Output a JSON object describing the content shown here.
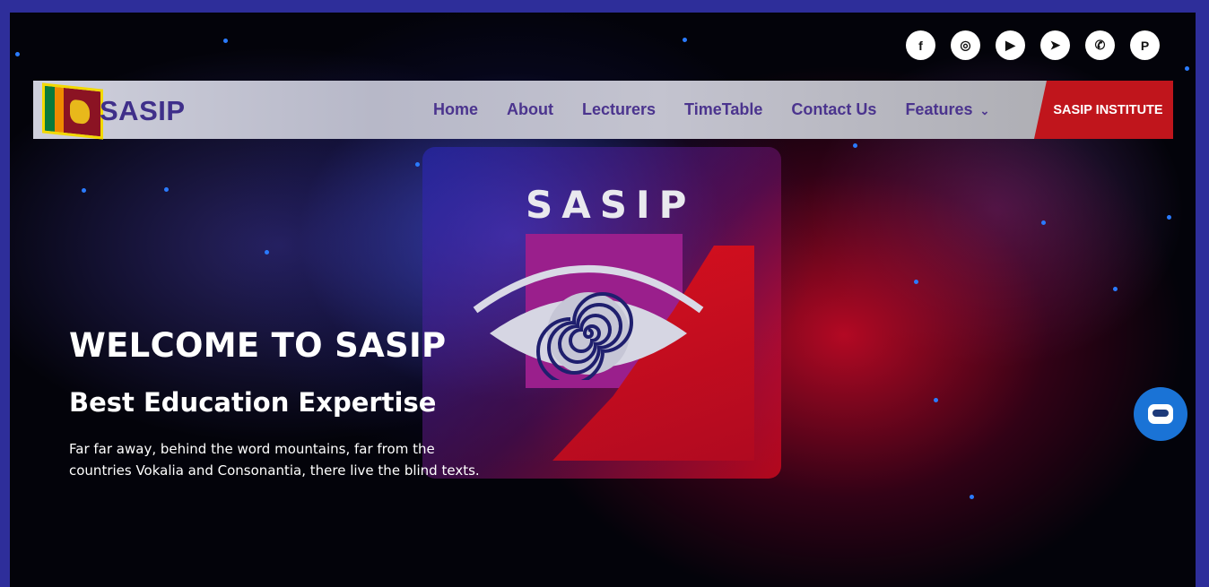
{
  "social": {
    "icons": [
      "facebook-icon",
      "instagram-icon",
      "youtube-icon",
      "telegram-icon",
      "whatsapp-icon",
      "pinterest-icon"
    ],
    "glyphs": [
      "f",
      "◎",
      "▶",
      "➤",
      "✆",
      "P"
    ]
  },
  "navbar": {
    "logo_text": "SASIP",
    "menu": [
      "Home",
      "About",
      "Lecturers",
      "TimeTable",
      "Contact Us",
      "Features"
    ],
    "features_chevron": "⌄",
    "cta": "SASIP INSTITUTE"
  },
  "emblem": {
    "word": "SASIP"
  },
  "hero": {
    "title": "WELCOME TO SASIP",
    "subtitle": "Best Education Expertise",
    "body": "Far far away, behind the word mountains, far from the countries Vokalia and Consonantia, there live the blind texts."
  },
  "colors": {
    "accent": "#c0151c",
    "menu_text": "#4b348e",
    "frame": "#2e2e9a",
    "chat": "#1a73d6"
  }
}
